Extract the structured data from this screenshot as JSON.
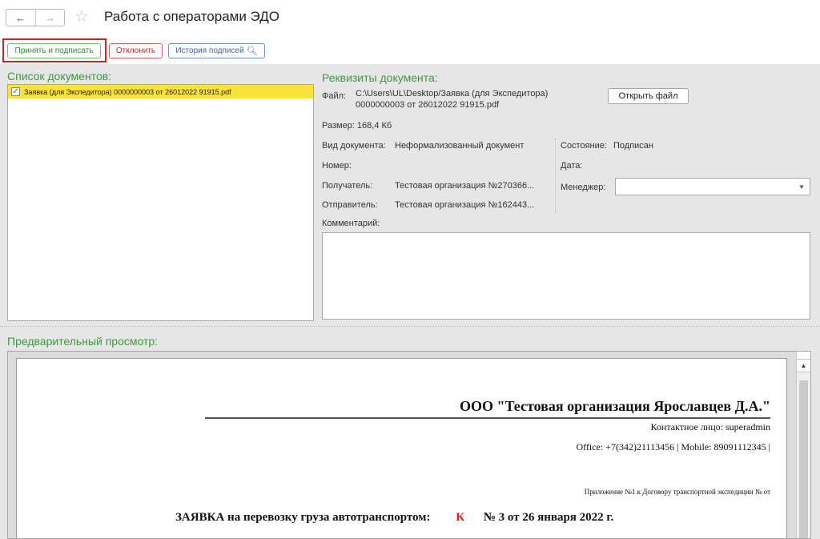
{
  "window": {
    "title": "Работа с операторами ЭДО",
    "back_glyph": "←",
    "forward_glyph": "→",
    "star_glyph": "☆"
  },
  "toolbar": {
    "accept_label": "Принять и подписать",
    "reject_label": "Отклонить",
    "history_label": "История подписей",
    "history_icon": "magnifier-icon"
  },
  "document_list": {
    "title": "Список документов:",
    "items": [
      {
        "checked": true,
        "label": "Заявка (для Экспедитора) 0000000003 от 26012022 91915.pdf"
      }
    ]
  },
  "details": {
    "title": "Реквизиты документа:",
    "file_label": "Файл:",
    "file_line1": "C:\\Users\\UL\\Desktop/Заявка (для Экспедитора)",
    "file_line2": "0000000003 от 26012022 91915.pdf",
    "open_file_label": "Открыть файл",
    "size_text": "Размер: 168,4 Кб",
    "doc_type_label": "Вид документа:",
    "doc_type_value": "Неформализованный документ",
    "number_label": "Номер:",
    "recipient_label": "Получатель:",
    "recipient_value": "Тестовая организация №270366...",
    "sender_label": "Отправитель:",
    "sender_value": "Тестовая организация №162443...",
    "state_label": "Состояние:",
    "state_value": "Подписан",
    "date_label": "Дата:",
    "manager_label": "Менеджер:",
    "manager_value": "",
    "comment_label": "Комментарий:",
    "comment_value": ""
  },
  "preview": {
    "title": "Предварительный просмотр:",
    "org_name": "ООО \"Тестовая организация Ярославцев Д.А.\"",
    "contact": "Контактное лицо: superadmin",
    "phones": "Office: +7(342)21113456 | Mobile: 89091112345 |",
    "appendix": "Приложение №1 к Договору транспортной экспедиции №  от",
    "heading": "ЗАЯВКА на перевозку груза автотранспортом:",
    "heading_k": "К",
    "heading_number": "№ 3 от 26 января 2022 г."
  },
  "colors": {
    "accent_green": "#3c9b3c",
    "reject_red": "#d02020",
    "highlight_frame": "#e01b1b",
    "selected_row": "#fbe23a",
    "history_blue": "#3d62b8"
  }
}
